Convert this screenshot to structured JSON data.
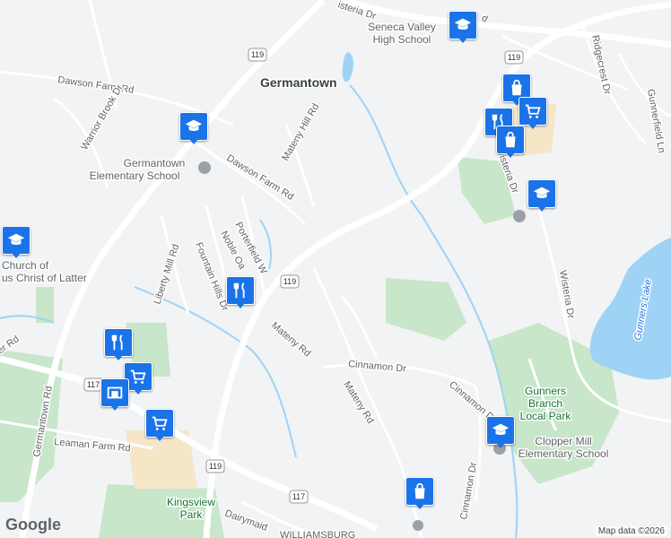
{
  "map": {
    "city": "Germantown",
    "roads": {
      "dawson_farm_rd_1": "Dawson Farm Rd",
      "dawson_farm_rd_2": "Dawson Farm Rd",
      "warrior_brook_dr": "Warrior Brook Dr",
      "mateny_hill_rd": "Mateny Hill Rd",
      "porterfield": "Porterfield W",
      "noble_oak": "Noble Oa",
      "fountain_hills": "Fountain Hills Dr",
      "liberty_mill": "Liberty Mill Rd",
      "mateny_rd_1": "Mateny Rd",
      "mateny_rd_2": "Mateny Rd",
      "cinnamon_dr_1": "Cinnamon Dr",
      "cinnamon_dr_2": "Cinnamon Dr",
      "cinnamon_dr_3": "Cinnamon Dr",
      "germantown_rd": "Germantown Rd",
      "leaman_farm": "Leaman Farm Rd",
      "wisteria_dr_1": "Wisteria Dr",
      "wisteria_dr_2": "Wisteria Dr",
      "wisteria_dr_top": "isteria Dr",
      "ridgecrest": "Ridgecrest Dr",
      "gunnerfield": "Gunnerfield Ln",
      "er_rd": "er Rd",
      "dairymaid": "Dairymaid",
      "williamsburg": "WILLIAMSBURG",
      "top_road": "d"
    },
    "shields": [
      "119",
      "119",
      "119",
      "119",
      "117",
      "117"
    ],
    "places": {
      "seneca_valley_1": "Seneca Valley",
      "seneca_valley_2": "High School",
      "germantown_elem_1": "Germantown",
      "germantown_elem_2": "Elementary School",
      "church_1": "Church of",
      "church_2": "us Christ of Latter",
      "gunners_branch_1": "Gunners",
      "gunners_branch_2": "Branch",
      "gunners_branch_3": "Local Park",
      "clopper_mill_1": "Clopper Mill",
      "clopper_mill_2": "Elementary School",
      "kingsview_1": "Kingsview",
      "kingsview_2": "Park",
      "gunners_lake": "Gunners Lake"
    },
    "colors": {
      "background": "#f1f3f4",
      "road": "#ffffff",
      "highway": "#ffffff",
      "park": "#c8e6c9",
      "water": "#9fd3f5",
      "pin": "#1a73e8"
    }
  },
  "pins": [
    {
      "icon": "school-icon"
    },
    {
      "icon": "school-icon"
    },
    {
      "icon": "school-icon"
    },
    {
      "icon": "shopping-bag-icon"
    },
    {
      "icon": "shopping-bag-icon"
    },
    {
      "icon": "restaurant-icon"
    },
    {
      "icon": "restaurant-icon"
    },
    {
      "icon": "shopping-cart-icon"
    },
    {
      "icon": "shopping-cart-icon"
    },
    {
      "icon": "school-icon"
    },
    {
      "icon": "school-icon"
    },
    {
      "icon": "shopping-bag-icon"
    }
  ],
  "attribution": {
    "logo": "Google",
    "map_data": "Map data ©2026"
  }
}
